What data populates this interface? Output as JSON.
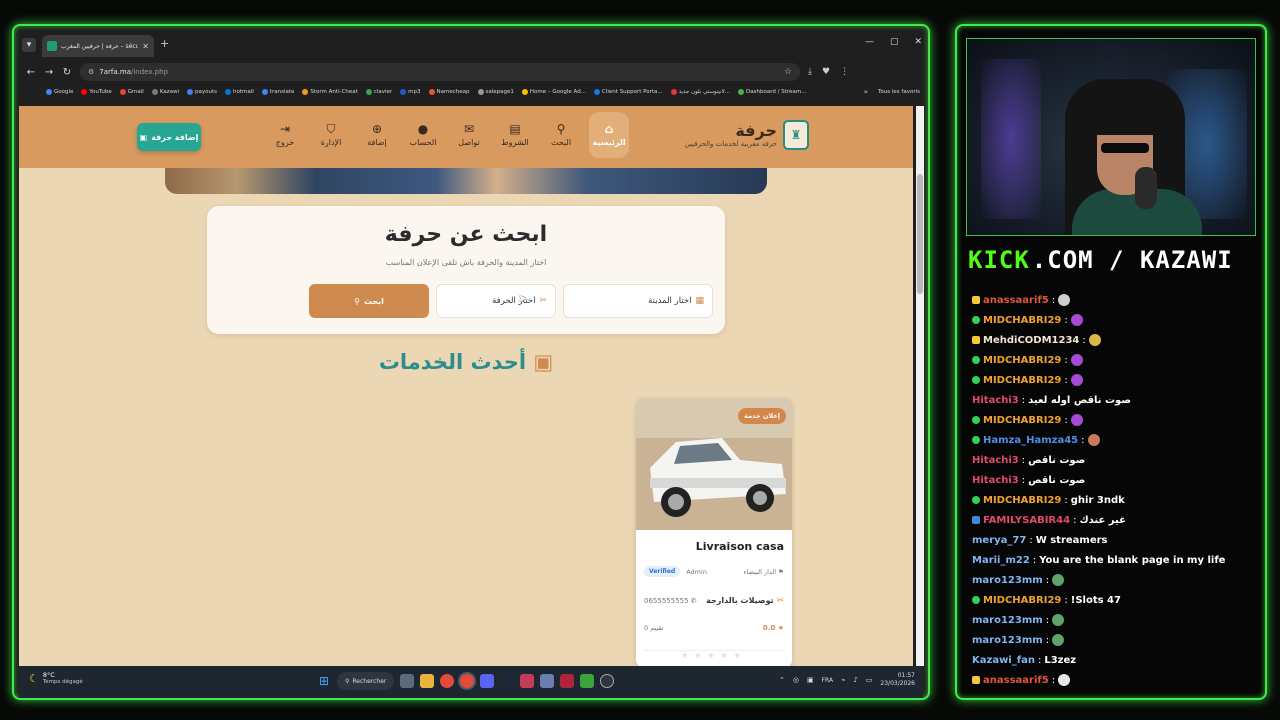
{
  "browser": {
    "tab_title": "حرفة | حرفيين المغرب – sécurité",
    "url_host": "7arfa.ma",
    "url_path": "/index.php",
    "bookmarks": [
      "Google",
      "YouTube",
      "Gmail",
      "Kazawi",
      "payouts",
      "hotmail",
      "translate",
      "Storm Anti-Cheat",
      "clavier",
      "mp3",
      "Namecheap",
      "salepage1",
      "Home – Google Ad...",
      "Client Support Porta...",
      "لانيتوستي بلون جديد...",
      "Dashboard / Stream..."
    ],
    "bookmarks_folder": "Tous les favoris"
  },
  "site": {
    "brand_name": "حرفة",
    "brand_sub": "حرفة مغربية لخدمات والحرفيين",
    "nav": [
      {
        "label": "الرئيسية",
        "icon": "home-icon",
        "glyph": "⌂",
        "active": true
      },
      {
        "label": "البحث",
        "icon": "search-icon",
        "glyph": "⚲",
        "active": false
      },
      {
        "label": "الشروط",
        "icon": "document-icon",
        "glyph": "▤",
        "active": false
      },
      {
        "label": "تواصل",
        "icon": "mail-icon",
        "glyph": "✉",
        "active": false
      },
      {
        "label": "الحساب",
        "icon": "user-icon",
        "glyph": "●",
        "active": false
      },
      {
        "label": "إضافة",
        "icon": "plus-circle-icon",
        "glyph": "⊕",
        "active": false
      },
      {
        "label": "الإدارة",
        "icon": "shield-icon",
        "glyph": "⛉",
        "active": false
      },
      {
        "label": "خروج",
        "icon": "logout-icon",
        "glyph": "⇥",
        "active": false
      }
    ],
    "add_button": "إضافة حرفة",
    "search": {
      "title": "ابحث عن حرفة",
      "subtitle": "اختار المدينة والحرفة باش تلقى الإعلان المناسب",
      "city_placeholder": "اختار المدينة",
      "craft_placeholder": "اختار الحرفة",
      "button": "ابحث"
    },
    "section_title": "أحدث الخدمات",
    "cards": [
      {
        "badge": "إعلان خدمة",
        "title": "Livraison casa",
        "city": "الدار البيضاء",
        "author": "Admin",
        "verified": "Verified",
        "category": "توصيلات بالدارجة",
        "phone": "0655555555",
        "rating": "0.0",
        "reviews": "0 تقييم"
      }
    ]
  },
  "taskbar": {
    "temp": "8°C",
    "weather": "Temps dégagé",
    "search": "Rechercher",
    "lang": "FRA",
    "time": "01:57",
    "date": "23/03/2026"
  },
  "stream": {
    "kick_prefix": "KICK",
    "kick_suffix": ".COM / KAZAWI",
    "chat": [
      {
        "user": "anassaarif5",
        "color": "#e0563b",
        "badge": "crown",
        "text": "",
        "emote": "#cfcfcf"
      },
      {
        "user": "MIDCHABRI29",
        "color": "#f2a12e",
        "badge": "sub",
        "text": "",
        "emote": "#a64bd6"
      },
      {
        "user": "MehdiCODM1234",
        "color": "#f0e6d0",
        "badge": "crown",
        "text": "",
        "emote": "#d9b84a"
      },
      {
        "user": "MIDCHABRI29",
        "color": "#f2a12e",
        "badge": "sub",
        "text": "",
        "emote": "#a64bd6"
      },
      {
        "user": "MIDCHABRI29",
        "color": "#f2a12e",
        "badge": "sub",
        "text": "",
        "emote": "#a64bd6"
      },
      {
        "user": "Hitachi3",
        "color": "#e34a6b",
        "badge": "",
        "text": "صوت ناقص اوله لعيد",
        "emote": ""
      },
      {
        "user": "MIDCHABRI29",
        "color": "#f2a12e",
        "badge": "sub",
        "text": "",
        "emote": "#a64bd6"
      },
      {
        "user": "Hamza_Hamza45",
        "color": "#4e8fe8",
        "badge": "sub",
        "text": "",
        "emote": "#c87a5a"
      },
      {
        "user": "Hitachi3",
        "color": "#e34a6b",
        "badge": "",
        "text": "صوت ناقص",
        "emote": ""
      },
      {
        "user": "Hitachi3",
        "color": "#e34a6b",
        "badge": "",
        "text": "صوت ناقص",
        "emote": ""
      },
      {
        "user": "MIDCHABRI29",
        "color": "#f2a12e",
        "badge": "sub",
        "text": "ghir 3ndk",
        "emote": ""
      },
      {
        "user": "FAMILYSABIR44",
        "color": "#e34a6b",
        "badge": "vip",
        "text": "غير عندك",
        "emote": ""
      },
      {
        "user": "merya_77",
        "color": "#7fb6f0",
        "badge": "",
        "text": "W streamers",
        "emote": ""
      },
      {
        "user": "Marii_m22",
        "color": "#7fb6f0",
        "badge": "",
        "text": "You are the blank page in my life",
        "emote": ""
      },
      {
        "user": "maro123mm",
        "color": "#7fb6f0",
        "badge": "",
        "text": "",
        "emote": "#5fa36a"
      },
      {
        "user": "MIDCHABRI29",
        "color": "#f2a12e",
        "badge": "sub",
        "text": "!Slots 47",
        "emote": ""
      },
      {
        "user": "maro123mm",
        "color": "#7fb6f0",
        "badge": "",
        "text": "",
        "emote": "#5fa36a"
      },
      {
        "user": "maro123mm",
        "color": "#7fb6f0",
        "badge": "",
        "text": "",
        "emote": "#5fa36a"
      },
      {
        "user": "Kazawi_fan",
        "color": "#7fb6f0",
        "badge": "",
        "text": "L3zez",
        "emote": ""
      },
      {
        "user": "anassaarif5",
        "color": "#e0563b",
        "badge": "crown",
        "text": "",
        "emote": "#e8e8e8"
      }
    ]
  },
  "colors": {
    "frame_green": "#43e84b",
    "kick_green": "#53fc18",
    "header": "#d89a5f",
    "page_bg": "#ecd7b4",
    "teal": "#27a694",
    "orange": "#cf8a4f"
  }
}
